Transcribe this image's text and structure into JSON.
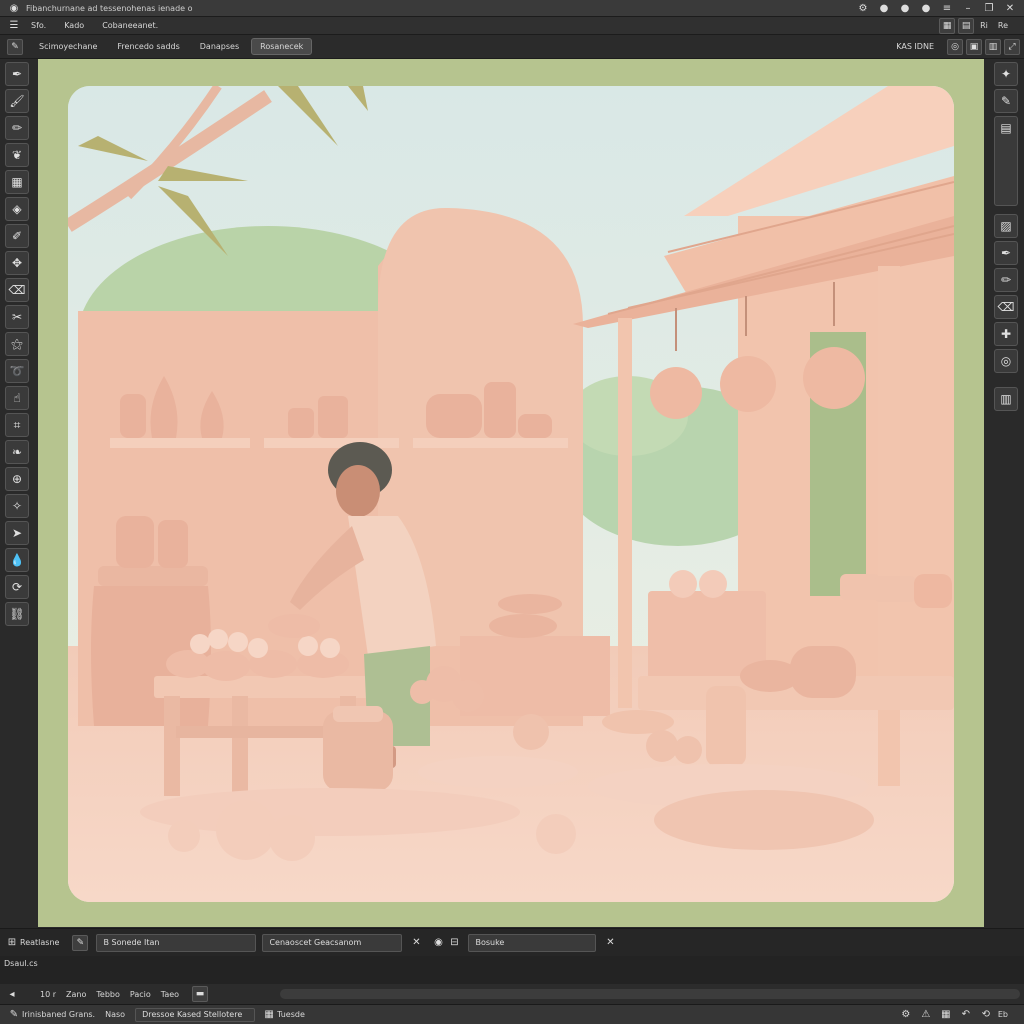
{
  "titlebar": {
    "title": "Fibanchurnane ad tessenohenas ienade o"
  },
  "menu": [
    "Sfo.",
    "Kado",
    "Cobaneeanet."
  ],
  "tabs": [
    "Scimoyechane",
    "Frencedo sadds",
    "Danapses",
    "Rosanecek"
  ],
  "tab_right_label": "KAS IDNE",
  "top_right_buttons": [
    "Ri",
    "Re"
  ],
  "bottom_panel": {
    "label1": "Reatlasne",
    "field1": "B Sonede Itan",
    "field2": "Cenaoscet Geacsanom",
    "field3": "Bosuke",
    "frame_label": "Dsaul.cs",
    "zoom": "10 r",
    "items": [
      "Zano",
      "Tebbo",
      "Pacio",
      "Taeo"
    ]
  },
  "statusbar": {
    "left": "Irinisbaned Grans.",
    "mid": "Naso",
    "doc": "Dressoe Kased Stellotere",
    "page": "Tuesde",
    "right": "Eb"
  },
  "icons": {
    "title_left": "eye-icon",
    "left_tools": [
      "pen-icon",
      "brush-icon",
      "pencil-icon",
      "feather-icon",
      "grid-icon",
      "bucket-icon",
      "quill-icon",
      "transform-icon",
      "eraser-icon",
      "scissors-icon",
      "wand-icon",
      "lasso-icon",
      "smudge-icon",
      "crop-icon",
      "leaf-icon",
      "target-icon",
      "star-icon",
      "cursor-icon",
      "droplet-icon",
      "rotate-icon",
      "link-icon"
    ],
    "right_tools": [
      "wand-icon",
      "brush-icon",
      "layer-icon",
      "swatch-icon",
      "pen-icon",
      "pencil-icon",
      "eraser-icon",
      "compass-icon"
    ]
  },
  "colors": {
    "frame": "#b6c48f",
    "sky": "#dfeae4",
    "clay": "#f0c3ae"
  }
}
